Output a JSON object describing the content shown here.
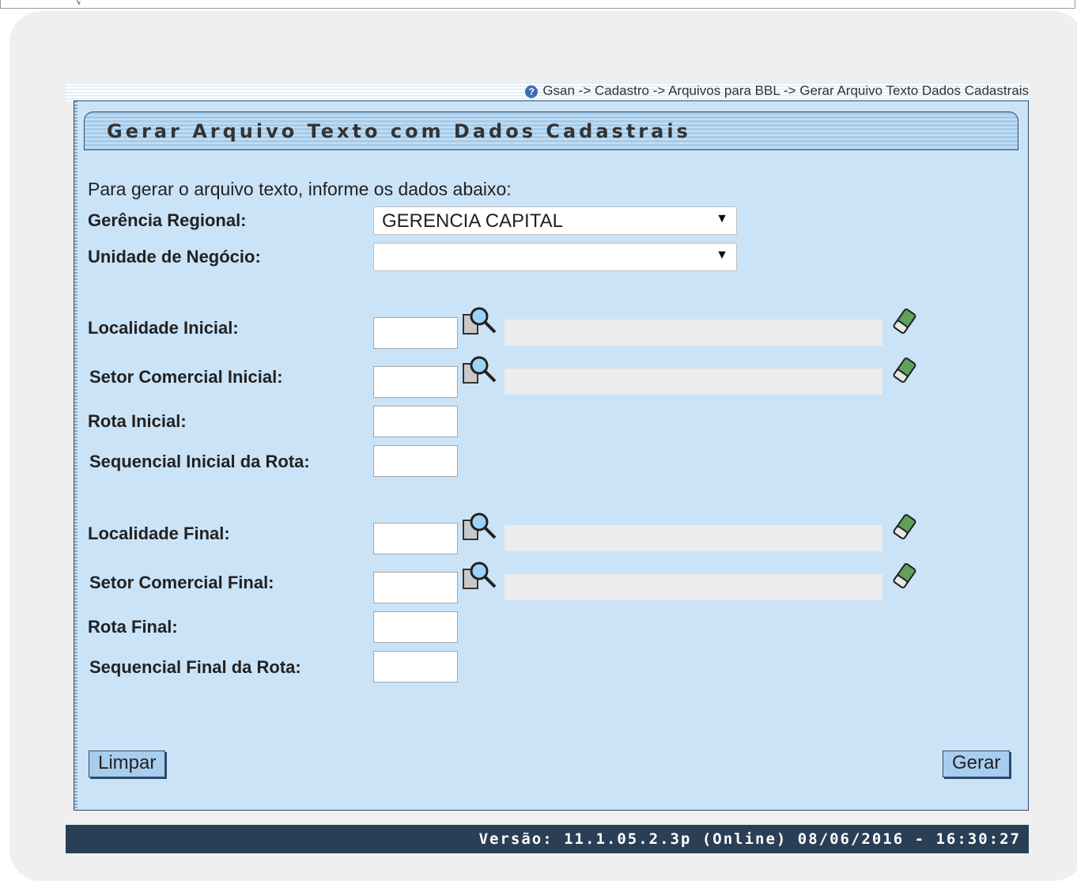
{
  "top_bar_text": "ç",
  "breadcrumb": "Gsan -> Cadastro -> Arquivos para BBL -> Gerar Arquivo Texto Dados Cadastrais",
  "title": "Gerar Arquivo Texto com Dados Cadastrais",
  "intro": "Para gerar o arquivo texto, informe os dados abaixo:",
  "fields": {
    "gerencia_label": "Gerência Regional:",
    "gerencia_value": "GERENCIA CAPITAL",
    "unidade_label": "Unidade de Negócio:",
    "unidade_value": "",
    "localidade_inicial_label": "Localidade Inicial:",
    "setor_inicial_label": "Setor Comercial Inicial:",
    "rota_inicial_label": "Rota Inicial:",
    "seq_inicial_label": "Sequencial Inicial da Rota:",
    "localidade_final_label": "Localidade Final:",
    "setor_final_label": "Setor Comercial Final:",
    "rota_final_label": "Rota Final:",
    "seq_final_label": "Sequencial Final da Rota:"
  },
  "buttons": {
    "limpar": "Limpar",
    "gerar": "Gerar"
  },
  "footer": "Versão: 11.1.05.2.3p (Online) 08/06/2016 - 16:30:27",
  "icons": {
    "help": "help-icon",
    "lookup": "magnifier-icon",
    "eraser": "eraser-icon",
    "dropdown": "dropdown-arrow-icon"
  }
}
